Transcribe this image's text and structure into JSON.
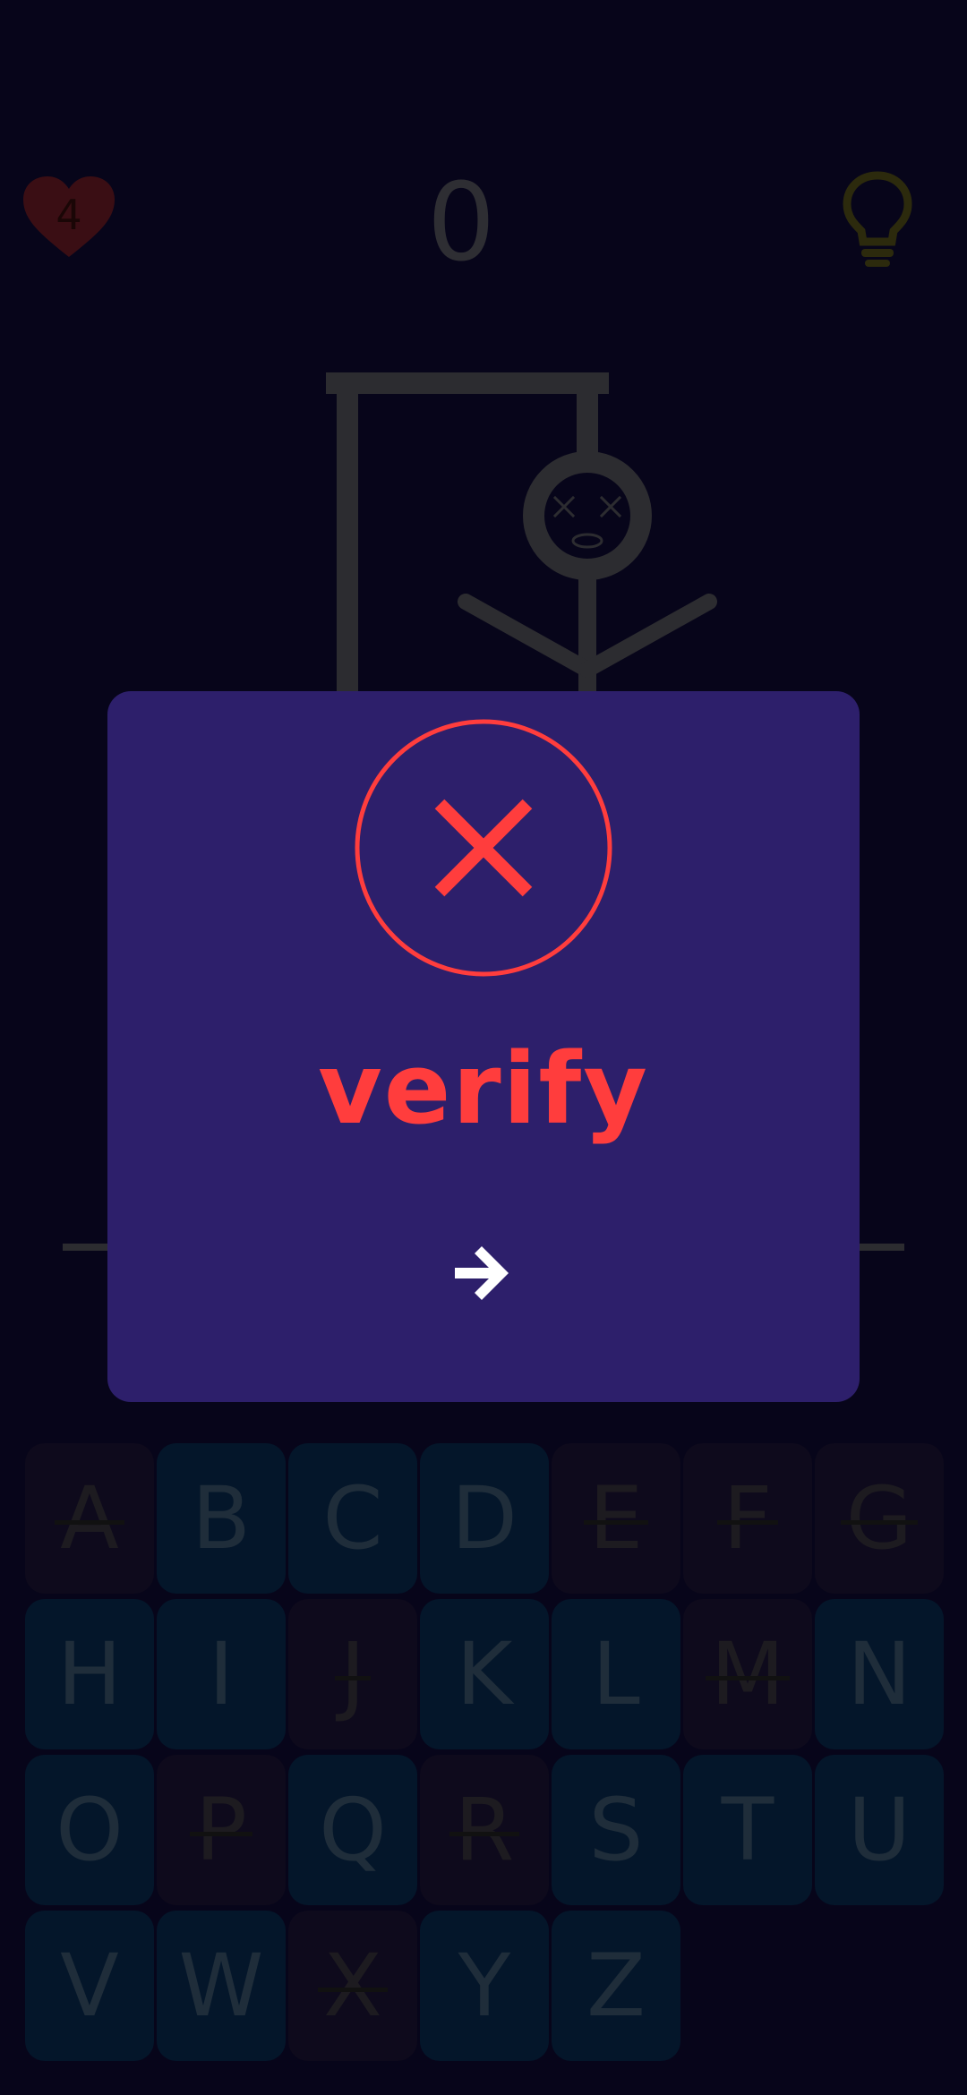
{
  "header": {
    "lives": "4",
    "score": "0"
  },
  "dialog": {
    "answer": "verify"
  },
  "keyboard": {
    "keys": [
      {
        "letter": "A",
        "state": "used"
      },
      {
        "letter": "B",
        "state": "available"
      },
      {
        "letter": "C",
        "state": "available"
      },
      {
        "letter": "D",
        "state": "available"
      },
      {
        "letter": "E",
        "state": "used"
      },
      {
        "letter": "F",
        "state": "used"
      },
      {
        "letter": "G",
        "state": "used"
      },
      {
        "letter": "H",
        "state": "available"
      },
      {
        "letter": "I",
        "state": "available"
      },
      {
        "letter": "J",
        "state": "used"
      },
      {
        "letter": "K",
        "state": "available"
      },
      {
        "letter": "L",
        "state": "available"
      },
      {
        "letter": "M",
        "state": "used"
      },
      {
        "letter": "N",
        "state": "available"
      },
      {
        "letter": "O",
        "state": "available"
      },
      {
        "letter": "P",
        "state": "used"
      },
      {
        "letter": "Q",
        "state": "available"
      },
      {
        "letter": "R",
        "state": "used"
      },
      {
        "letter": "S",
        "state": "available"
      },
      {
        "letter": "T",
        "state": "available"
      },
      {
        "letter": "U",
        "state": "available"
      },
      {
        "letter": "V",
        "state": "available"
      },
      {
        "letter": "W",
        "state": "available"
      },
      {
        "letter": "X",
        "state": "used"
      },
      {
        "letter": "Y",
        "state": "available"
      },
      {
        "letter": "Z",
        "state": "available"
      }
    ]
  },
  "colors": {
    "background": "#07051a",
    "dialog": "#2d1f6b",
    "fail_red": "#ff3d3d"
  }
}
